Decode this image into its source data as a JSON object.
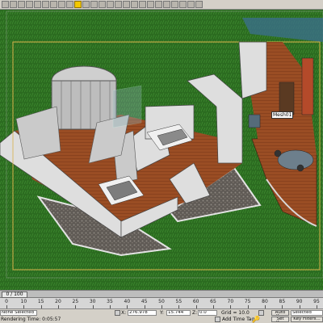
{
  "app": {
    "accent": "#f2c800"
  },
  "viewport": {
    "object_tag": "Mesh01"
  },
  "frame_slider": {
    "label": "0 / 100"
  },
  "timeline": {
    "ticks": [
      "0",
      "10",
      "15",
      "20",
      "25",
      "30",
      "35",
      "40",
      "45",
      "50",
      "55",
      "60",
      "65",
      "70",
      "75",
      "80",
      "85",
      "90",
      "95"
    ]
  },
  "status": {
    "selection": "None Selected",
    "render_time": "Rendering Time: 0:05:57",
    "x_label": "X:",
    "x_value": "276.978",
    "y_label": "Y:",
    "y_value": "15.744",
    "z_label": "Z:",
    "z_value": "0.0",
    "grid": "Grid = 10.0",
    "add_time_tag": "Add Time Tag",
    "auto_key": "Auto Key",
    "selected": "Selected",
    "set_key": "Set Key",
    "key_filters": "Key Filters..."
  },
  "colors": {
    "grass": "#2b6b20",
    "floor": "#9a4d24",
    "wall": "#dcdcdc",
    "gravel": "#6a6560"
  }
}
